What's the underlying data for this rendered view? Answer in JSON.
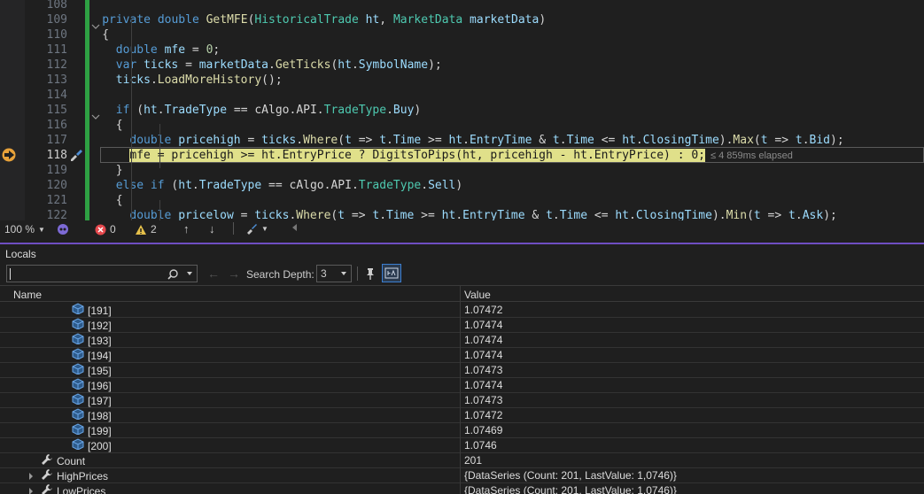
{
  "editor": {
    "lines": [
      {
        "n": "108",
        "tokens": []
      },
      {
        "n": "109",
        "tokens": [
          [
            "kw",
            "private "
          ],
          [
            "kw",
            "double "
          ],
          [
            "fn",
            "GetMFE"
          ],
          [
            "p",
            "("
          ],
          [
            "ty",
            "HistoricalTrade "
          ],
          [
            "vr",
            "ht"
          ],
          [
            "p",
            ", "
          ],
          [
            "ty",
            "MarketData "
          ],
          [
            "vr",
            "marketData"
          ],
          [
            "p",
            ")"
          ]
        ],
        "indent": 4
      },
      {
        "n": "110",
        "tokens": [
          [
            "p",
            "{"
          ]
        ],
        "indent": 4
      },
      {
        "n": "111",
        "tokens": [
          [
            "kw",
            "double "
          ],
          [
            "vr",
            "mfe"
          ],
          [
            "p",
            " = "
          ],
          [
            "nu",
            "0"
          ],
          [
            "p",
            ";"
          ]
        ],
        "indent": 6
      },
      {
        "n": "112",
        "tokens": [
          [
            "kw",
            "var "
          ],
          [
            "vr",
            "ticks"
          ],
          [
            "p",
            " = "
          ],
          [
            "vr",
            "marketData"
          ],
          [
            "p",
            "."
          ],
          [
            "fn",
            "GetTicks"
          ],
          [
            "p",
            "("
          ],
          [
            "vr",
            "ht"
          ],
          [
            "p",
            "."
          ],
          [
            "vr",
            "SymbolName"
          ],
          [
            "p",
            ");"
          ]
        ],
        "indent": 6
      },
      {
        "n": "113",
        "tokens": [
          [
            "vr",
            "ticks"
          ],
          [
            "p",
            "."
          ],
          [
            "fn",
            "LoadMoreHistory"
          ],
          [
            "p",
            "();"
          ]
        ],
        "indent": 6
      },
      {
        "n": "114",
        "tokens": []
      },
      {
        "n": "115",
        "tokens": [
          [
            "kw",
            "if "
          ],
          [
            "p",
            "("
          ],
          [
            "vr",
            "ht"
          ],
          [
            "p",
            "."
          ],
          [
            "vr",
            "TradeType"
          ],
          [
            "p",
            " == "
          ],
          [
            "p",
            "cAlgo.API."
          ],
          [
            "ty",
            "TradeType"
          ],
          [
            "p",
            "."
          ],
          [
            "vr",
            "Buy"
          ],
          [
            "p",
            ")"
          ]
        ],
        "indent": 6
      },
      {
        "n": "116",
        "tokens": [
          [
            "p",
            "{"
          ]
        ],
        "indent": 6
      },
      {
        "n": "117",
        "tokens": [
          [
            "kw",
            "double "
          ],
          [
            "vr",
            "pricehigh"
          ],
          [
            "p",
            " = "
          ],
          [
            "vr",
            "ticks"
          ],
          [
            "p",
            "."
          ],
          [
            "fn",
            "Where"
          ],
          [
            "p",
            "("
          ],
          [
            "vr",
            "t"
          ],
          [
            "p",
            " => "
          ],
          [
            "vr",
            "t"
          ],
          [
            "p",
            "."
          ],
          [
            "vr",
            "Time"
          ],
          [
            "p",
            " >= "
          ],
          [
            "vr",
            "ht"
          ],
          [
            "p",
            "."
          ],
          [
            "vr",
            "EntryTime"
          ],
          [
            "p",
            " & "
          ],
          [
            "vr",
            "t"
          ],
          [
            "p",
            "."
          ],
          [
            "vr",
            "Time"
          ],
          [
            "p",
            " <= "
          ],
          [
            "vr",
            "ht"
          ],
          [
            "p",
            "."
          ],
          [
            "vr",
            "ClosingTime"
          ],
          [
            "p",
            ")."
          ],
          [
            "fn",
            "Max"
          ],
          [
            "p",
            "("
          ],
          [
            "vr",
            "t"
          ],
          [
            "p",
            " => "
          ],
          [
            "vr",
            "t"
          ],
          [
            "p",
            "."
          ],
          [
            "vr",
            "Bid"
          ],
          [
            "p",
            ");"
          ]
        ],
        "indent": 8
      },
      {
        "n": "118",
        "current": true,
        "highlight": "mfe = pricehigh >= ht.EntryPrice ? DigitsToPips(ht, pricehigh - ht.EntryPrice) : 0;",
        "elapsed": "≤ 4 859ms elapsed",
        "indent": 8
      },
      {
        "n": "119",
        "tokens": [
          [
            "p",
            "}"
          ]
        ],
        "indent": 6
      },
      {
        "n": "120",
        "tokens": [
          [
            "kw",
            "else if "
          ],
          [
            "p",
            "("
          ],
          [
            "vr",
            "ht"
          ],
          [
            "p",
            "."
          ],
          [
            "vr",
            "TradeType"
          ],
          [
            "p",
            " == "
          ],
          [
            "p",
            "cAlgo.API."
          ],
          [
            "ty",
            "TradeType"
          ],
          [
            "p",
            "."
          ],
          [
            "vr",
            "Sell"
          ],
          [
            "p",
            ")"
          ]
        ],
        "indent": 6
      },
      {
        "n": "121",
        "tokens": [
          [
            "p",
            "{"
          ]
        ],
        "indent": 6
      },
      {
        "n": "122",
        "tokens": [
          [
            "kw",
            "double "
          ],
          [
            "vr",
            "pricelow"
          ],
          [
            "p",
            " = "
          ],
          [
            "vr",
            "ticks"
          ],
          [
            "p",
            "."
          ],
          [
            "fn",
            "Where"
          ],
          [
            "p",
            "("
          ],
          [
            "vr",
            "t"
          ],
          [
            "p",
            " => "
          ],
          [
            "vr",
            "t"
          ],
          [
            "p",
            "."
          ],
          [
            "vr",
            "Time"
          ],
          [
            "p",
            " >= "
          ],
          [
            "vr",
            "ht"
          ],
          [
            "p",
            "."
          ],
          [
            "vr",
            "EntryTime"
          ],
          [
            "p",
            " & "
          ],
          [
            "vr",
            "t"
          ],
          [
            "p",
            "."
          ],
          [
            "vr",
            "Time"
          ],
          [
            "p",
            " <= "
          ],
          [
            "vr",
            "ht"
          ],
          [
            "p",
            "."
          ],
          [
            "vr",
            "ClosingTime"
          ],
          [
            "p",
            ")."
          ],
          [
            "fn",
            "Min"
          ],
          [
            "p",
            "("
          ],
          [
            "vr",
            "t"
          ],
          [
            "p",
            " => "
          ],
          [
            "vr",
            "t"
          ],
          [
            "p",
            "."
          ],
          [
            "vr",
            "Ask"
          ],
          [
            "p",
            ");"
          ]
        ],
        "indent": 8
      }
    ]
  },
  "status": {
    "zoom": "100 %",
    "errors": "0",
    "warnings": "2"
  },
  "locals": {
    "tab": "Locals",
    "search_depth_label": "Search Depth:",
    "search_depth": "3",
    "col_name": "Name",
    "col_value": "Value",
    "rows": [
      {
        "name": "[191]",
        "value": "1.07472"
      },
      {
        "name": "[192]",
        "value": "1.07474"
      },
      {
        "name": "[193]",
        "value": "1.07474"
      },
      {
        "name": "[194]",
        "value": "1.07474"
      },
      {
        "name": "[195]",
        "value": "1.07473"
      },
      {
        "name": "[196]",
        "value": "1.07474"
      },
      {
        "name": "[197]",
        "value": "1.07473"
      },
      {
        "name": "[198]",
        "value": "1.07472"
      },
      {
        "name": "[199]",
        "value": "1.07469"
      },
      {
        "name": "[200]",
        "value": "1.0746"
      }
    ],
    "props": [
      {
        "name": "Count",
        "value": "201",
        "expandable": false
      },
      {
        "name": "HighPrices",
        "value": "{DataSeries (Count: 201, LastValue: 1,0746)}",
        "expandable": true
      },
      {
        "name": "LowPrices",
        "value": "{DataSeries (Count: 201, LastValue: 1,0746)}",
        "expandable": true
      }
    ]
  }
}
